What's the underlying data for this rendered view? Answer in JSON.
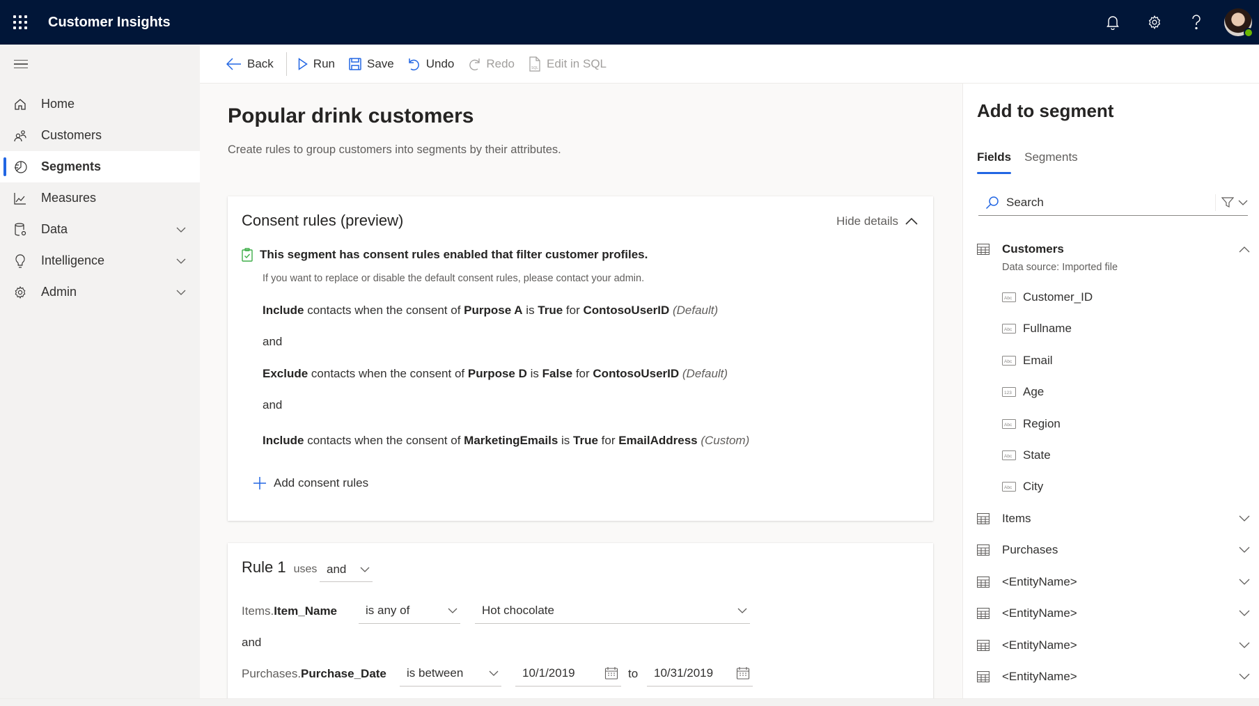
{
  "header": {
    "app_title": "Customer Insights",
    "icons": [
      "waffle-icon",
      "bell-icon",
      "gear-icon",
      "help-icon",
      "avatar"
    ]
  },
  "sidebar": {
    "items": [
      {
        "label": "Home",
        "icon": "home-icon",
        "active": false,
        "expandable": false
      },
      {
        "label": "Customers",
        "icon": "people-icon",
        "active": false,
        "expandable": false
      },
      {
        "label": "Segments",
        "icon": "segments-icon",
        "active": true,
        "expandable": false
      },
      {
        "label": "Measures",
        "icon": "chart-icon",
        "active": false,
        "expandable": false
      },
      {
        "label": "Data",
        "icon": "database-icon",
        "active": false,
        "expandable": true
      },
      {
        "label": "Intelligence",
        "icon": "lightbulb-icon",
        "active": false,
        "expandable": true
      },
      {
        "label": "Admin",
        "icon": "gear-icon",
        "active": false,
        "expandable": true
      }
    ]
  },
  "toolbar": {
    "back": "Back",
    "run": "Run",
    "save": "Save",
    "undo": "Undo",
    "redo": "Redo",
    "edit_sql": "Edit in SQL"
  },
  "page": {
    "title": "Popular drink customers",
    "subtitle": "Create rules to group customers into segments by their attributes."
  },
  "consent": {
    "title": "Consent rules (preview)",
    "hide_details": "Hide details",
    "notice": "This segment has consent rules enabled that filter customer profiles.",
    "notice_sub": "If you want to replace or disable the default consent rules, please contact your admin.",
    "rules": [
      {
        "action": "Include",
        "text1": " contacts when the consent of ",
        "purpose": "Purpose A",
        "text2": " is ",
        "value": "True",
        "text3": " for ",
        "key": "ContosoUserID",
        "tag": "(Default)"
      },
      {
        "action": "Exclude",
        "text1": " contacts when the consent of ",
        "purpose": "Purpose D",
        "text2": " is ",
        "value": "False",
        "text3": " for ",
        "key": "ContosoUserID",
        "tag": "(Default)"
      },
      {
        "action": "Include",
        "text1": " contacts when the consent of ",
        "purpose": "MarketingEmails",
        "text2": " is ",
        "value": "True",
        "text3": " for ",
        "key": "EmailAddress",
        "tag": "(Custom)"
      }
    ],
    "connector": "and",
    "add_label": "Add consent rules"
  },
  "rule1": {
    "title": "Rule 1",
    "uses": "uses",
    "combinator": "and",
    "conditions": [
      {
        "entity": "Items.",
        "field": "Item_Name",
        "operator": "is any of",
        "value": "Hot chocolate"
      },
      {
        "entity": "Purchases.",
        "field": "Purchase_Date",
        "operator": "is between",
        "from": "10/1/2019",
        "to_label": "to",
        "to": "10/31/2019"
      }
    ],
    "connector": "and"
  },
  "panel": {
    "title": "Add to segment",
    "tabs": [
      {
        "label": "Fields",
        "active": true
      },
      {
        "label": "Segments",
        "active": false
      }
    ],
    "search_placeholder": "Search",
    "customers": {
      "name": "Customers",
      "source": "Data source: Imported file",
      "fields": [
        {
          "name": "Customer_ID",
          "type": "text"
        },
        {
          "name": "Fullname",
          "type": "text"
        },
        {
          "name": "Email",
          "type": "text"
        },
        {
          "name": "Age",
          "type": "number"
        },
        {
          "name": "Region",
          "type": "text"
        },
        {
          "name": "State",
          "type": "text"
        },
        {
          "name": "City",
          "type": "text"
        }
      ]
    },
    "entities": [
      "Items",
      "Purchases",
      "<EntityName>",
      "<EntityName>",
      "<EntityName>",
      "<EntityName>"
    ]
  }
}
